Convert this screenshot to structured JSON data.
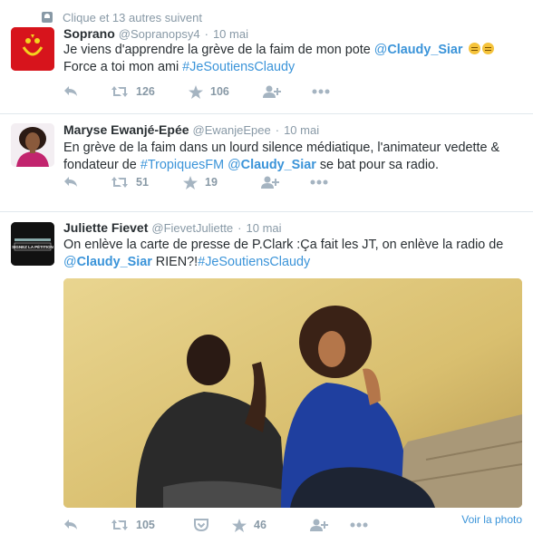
{
  "context": {
    "text": "Clique et 13 autres suivent",
    "icon": "follow-icon"
  },
  "tweets": [
    {
      "fullname": "Soprano",
      "username": "@Sopranopsy4",
      "separator": "·",
      "time": "10 mai",
      "text_parts": [
        "Je viens d'apprendre la grève de la faim de mon pote ",
        "@",
        "Claudy_Siar",
        "Force a toi mon ami ",
        "#JeSoutiensClaudy"
      ],
      "emoji": "relieved-face-emoji",
      "actions": {
        "retweets": "126",
        "favorites": "106"
      }
    },
    {
      "fullname": "Maryse Ewanjé-Epée",
      "username": "@EwanjeEpee",
      "separator": "·",
      "time": "10 mai",
      "text_parts": [
        "En grève de la faim dans un lourd silence médiatique, l'animateur vedette &",
        "fondateur de ",
        "#TropiquesFM",
        "@",
        "Claudy_Siar",
        " se bat pour sa radio."
      ],
      "actions": {
        "retweets": "51",
        "favorites": "19"
      }
    },
    {
      "fullname": "Juliette Fievet",
      "username": "@FievetJuliette",
      "separator": "·",
      "time": "10 mai",
      "text_parts": [
        "On enlève la carte de presse de P.Clark :Ça fait les JT, on enlève la radio de",
        "@",
        "Claudy_Siar",
        " RIEN?!",
        "#JeSoutiensClaudy"
      ],
      "avatar_text": "SIGNEZ LA PÉTITION",
      "actions": {
        "retweets": "105",
        "favorites": "46"
      },
      "photo_link": "Voir la photo"
    }
  ],
  "colors": {
    "link": "#3b94d9",
    "muted": "#8899a6",
    "icon": "#a5b4c1",
    "text": "#292f33",
    "border": "#e1e8ed"
  }
}
